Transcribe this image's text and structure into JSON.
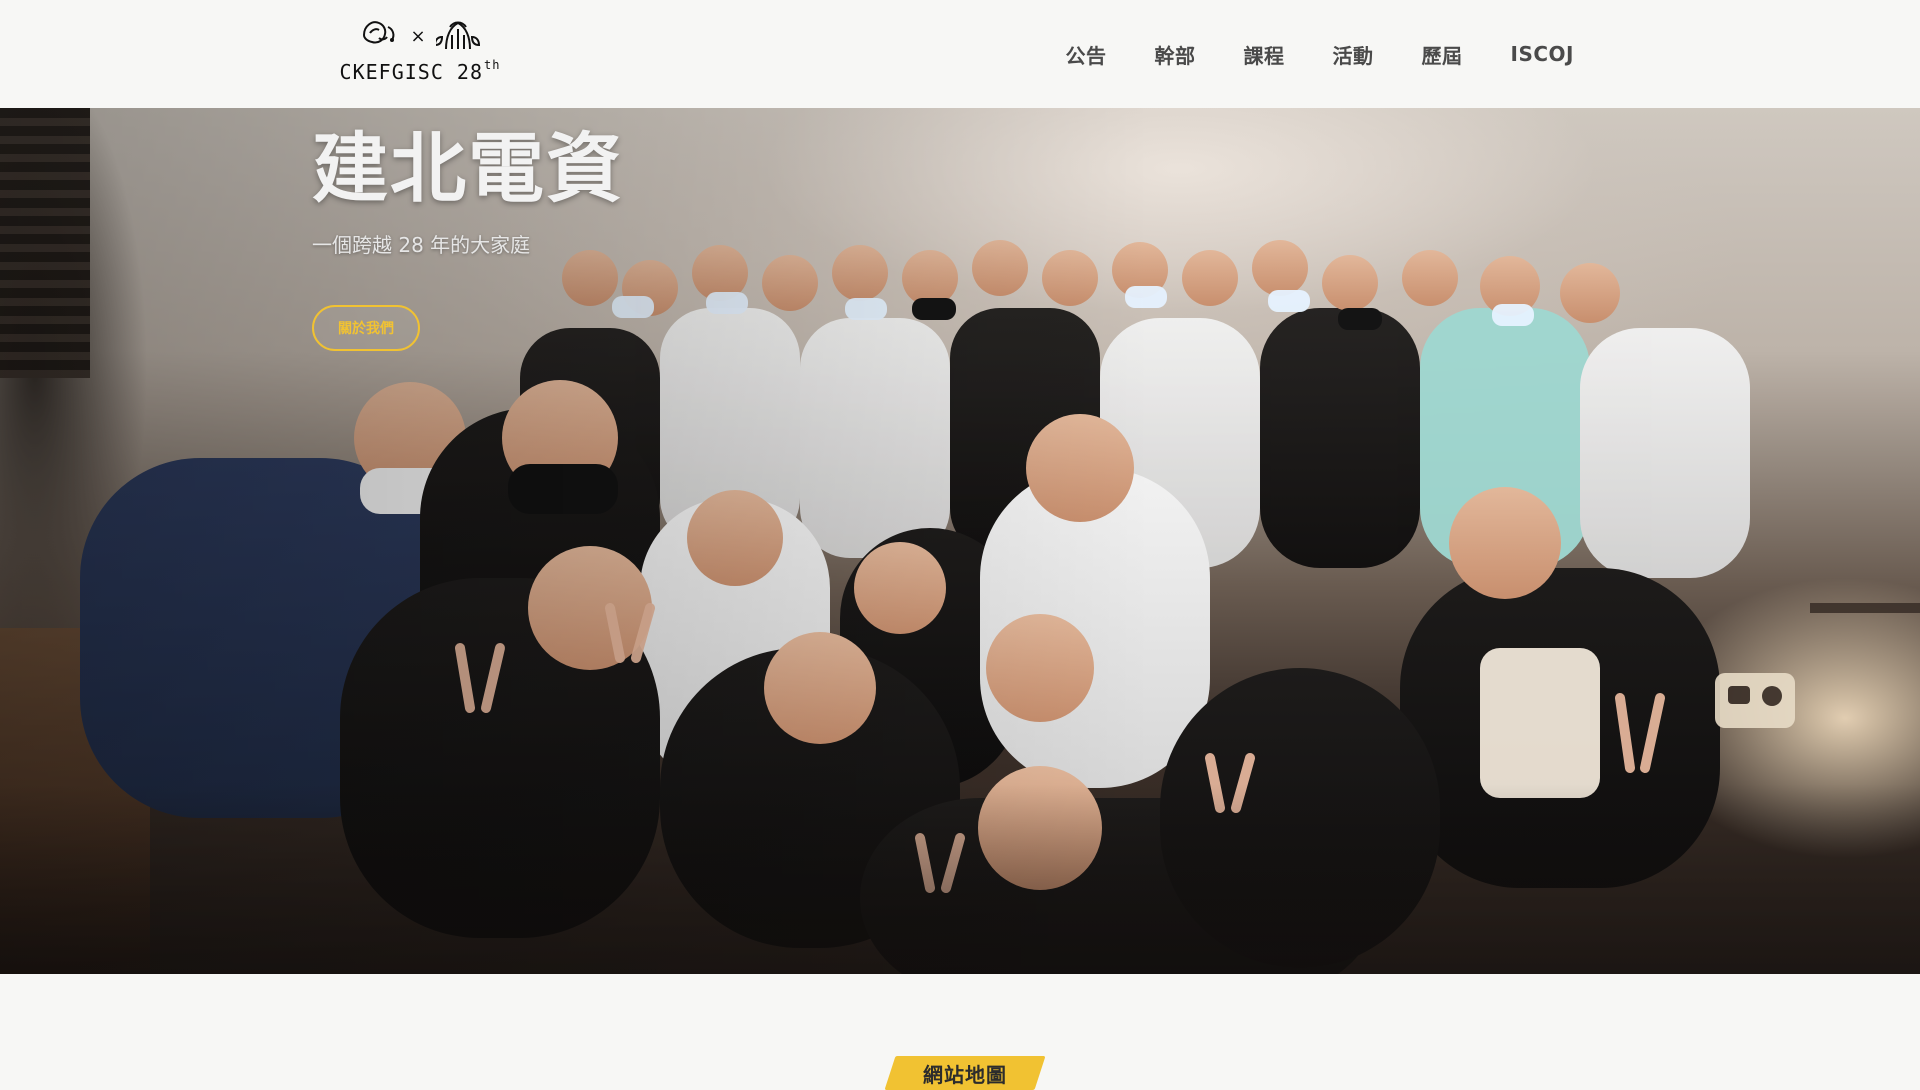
{
  "header": {
    "brand": {
      "text": "CKEFGISC 28",
      "superscript": "th",
      "separator": "×",
      "left_logo_icon": "ckef-logo-icon",
      "right_logo_icon": "gisc-logo-icon"
    },
    "nav": [
      {
        "label": "公告"
      },
      {
        "label": "幹部"
      },
      {
        "label": "課程"
      },
      {
        "label": "活動"
      },
      {
        "label": "歷屆"
      },
      {
        "label": "ISCOJ"
      }
    ]
  },
  "hero": {
    "title": "建北電資",
    "subtitle": "一個跨越 28 年的大家庭",
    "button_label": "關於我們"
  },
  "section": {
    "badge_label": "網站地圖",
    "badge_color": "#f1c232"
  },
  "colors": {
    "page_bg": "#f7f7f5",
    "nav_text": "#4a4a4a",
    "accent": "#f1c232",
    "hero_text": "#f2f2f2"
  }
}
